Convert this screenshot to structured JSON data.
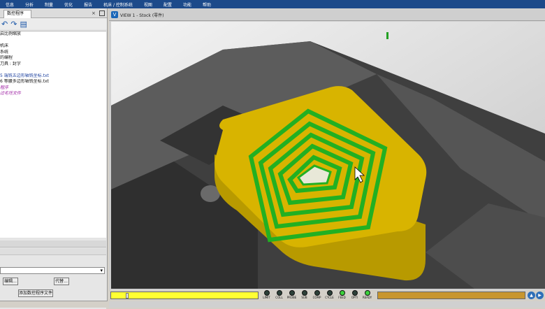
{
  "menu": [
    "信息",
    "分析",
    "制量",
    "优化",
    "报告",
    "机床 / 控制系统",
    "视图",
    "配置",
    "功能",
    "帮助"
  ],
  "left_panel": {
    "tab_label": "数控程序",
    "close_glyph": "×",
    "tree": [
      {
        "text": "启比例缩放",
        "style": "normal"
      },
      {
        "text": "",
        "style": "normal"
      },
      {
        "text": "机床",
        "style": "normal"
      },
      {
        "text": "系统",
        "style": "normal"
      },
      {
        "text": "的编程",
        "style": "normal"
      },
      {
        "text": "刀具 : 封字",
        "style": "normal"
      },
      {
        "text": "",
        "style": "normal"
      },
      {
        "text": "5 端铣五边形轴铣坐标.txt",
        "style": "blue"
      },
      {
        "text": "6 等腰多边形轴铣坐标.txt",
        "style": "normal"
      },
      {
        "text": "程序",
        "style": "purple"
      },
      {
        "text": "过毛坯文件",
        "style": "purple"
      }
    ],
    "edit_button": "编辑...",
    "replace_button": "代替...",
    "add_program_button": "添加数控程序文件"
  },
  "view": {
    "title": "VIEW 1 - Stock (零件)",
    "logo": "V"
  },
  "status_leds": [
    {
      "label": "LIMIT",
      "on": false
    },
    {
      "label": "COLL",
      "on": false
    },
    {
      "label": "PROBE",
      "on": false
    },
    {
      "label": "SUB",
      "on": false
    },
    {
      "label": "COMP",
      "on": false
    },
    {
      "label": "CYCLE",
      "on": false
    },
    {
      "label": "FEED",
      "on": true
    },
    {
      "label": "OPTI",
      "on": false
    },
    {
      "label": "READY",
      "on": true
    }
  ],
  "progress": {
    "simulation_fraction": 0.1
  },
  "colors": {
    "part": "#d4b300",
    "toolpath": "#22b022",
    "fixture": "#4a4a4a",
    "menubar": "#1c4a8a"
  }
}
